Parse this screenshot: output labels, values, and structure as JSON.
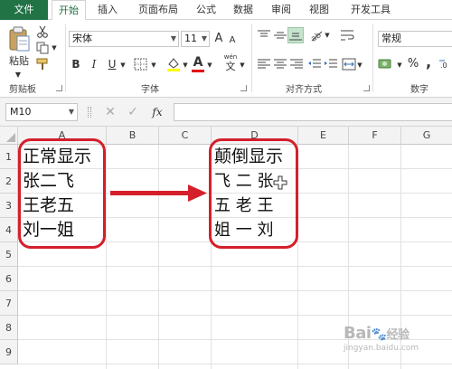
{
  "tabs": [
    "文件",
    "开始",
    "插入",
    "页面布局",
    "公式",
    "数据",
    "审阅",
    "视图",
    "开发工具"
  ],
  "active_tab": "开始",
  "ribbon": {
    "paste_label": "粘贴",
    "clipboard_group": "剪贴板",
    "font_group": "字体",
    "alignment_group": "对齐方式",
    "number_group": "数字",
    "font_name": "宋体",
    "font_size": "11",
    "number_format": "常规",
    "bold": "B",
    "italic": "I",
    "underline": "U",
    "font_color_letter": "A",
    "increase_font": "A",
    "decrease_font": "A",
    "percent": "%",
    "comma": ",",
    "wen_label": "wén",
    "wen_char": "文"
  },
  "formula_bar": {
    "name_box": "M10",
    "fx": "fx",
    "value": ""
  },
  "columns": [
    "A",
    "B",
    "C",
    "D",
    "E",
    "F",
    "G"
  ],
  "rows": [
    "1",
    "2",
    "3",
    "4",
    "5",
    "6",
    "7",
    "8",
    "9"
  ],
  "cells": {
    "A1": "正常显示",
    "A2": "张二飞",
    "A3": "王老五",
    "A4": "刘一姐",
    "D1": "颠倒显示",
    "D2": "飞 二 张",
    "D3": "五 老 王",
    "D4": "姐 一 刘"
  },
  "colors": {
    "accent": "#217346",
    "annotation_red": "#d51f2b"
  },
  "watermark": {
    "brand_prefix": "Bai",
    "brand_suffix": "经验",
    "url": "jingyan.baidu.com"
  }
}
